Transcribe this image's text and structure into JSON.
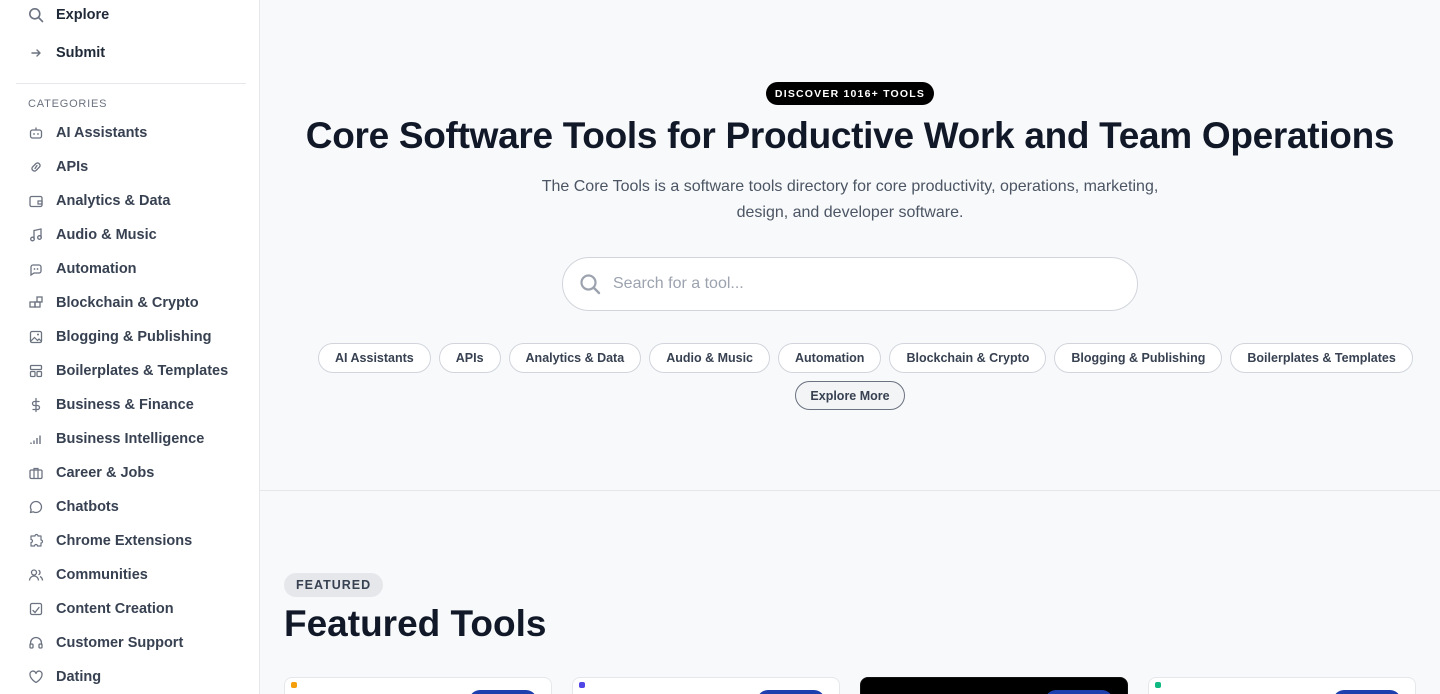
{
  "sidebar": {
    "top_items": [
      {
        "label": "Explore",
        "icon": "search-icon"
      },
      {
        "label": "Submit",
        "icon": "arrow-right-icon"
      }
    ],
    "categories_heading": "CATEGORIES",
    "categories": [
      {
        "label": "AI Assistants",
        "icon": "bot-icon"
      },
      {
        "label": "APIs",
        "icon": "link-icon"
      },
      {
        "label": "Analytics & Data",
        "icon": "wallet-icon"
      },
      {
        "label": "Audio & Music",
        "icon": "music-icon"
      },
      {
        "label": "Automation",
        "icon": "robot-icon"
      },
      {
        "label": "Blockchain & Crypto",
        "icon": "blocks-icon"
      },
      {
        "label": "Blogging & Publishing",
        "icon": "image-icon"
      },
      {
        "label": "Boilerplates & Templates",
        "icon": "template-icon"
      },
      {
        "label": "Business & Finance",
        "icon": "dollar-icon"
      },
      {
        "label": "Business Intelligence",
        "icon": "signal-icon"
      },
      {
        "label": "Career & Jobs",
        "icon": "briefcase-icon"
      },
      {
        "label": "Chatbots",
        "icon": "chat-bubble-icon"
      },
      {
        "label": "Chrome Extensions",
        "icon": "puzzle-icon"
      },
      {
        "label": "Communities",
        "icon": "users-icon"
      },
      {
        "label": "Content Creation",
        "icon": "edit-image-icon"
      },
      {
        "label": "Customer Support",
        "icon": "headset-icon"
      },
      {
        "label": "Dating",
        "icon": "heart-icon"
      }
    ]
  },
  "hero": {
    "badge": "DISCOVER 1016+ TOOLS",
    "title": "Core Software Tools for Productive Work and Team Operations",
    "subtitle_line1": "The Core Tools is a software tools directory for core productivity, operations, marketing,",
    "subtitle_line2": "design, and developer software.",
    "search_placeholder": "Search for a tool...",
    "search_value": "",
    "chips": [
      "AI Assistants",
      "APIs",
      "Analytics & Data",
      "Audio & Music",
      "Automation",
      "Blockchain & Crypto",
      "Blogging & Publishing",
      "Boilerplates & Templates"
    ],
    "explore_more": "Explore More"
  },
  "featured": {
    "tag": "FEATURED",
    "title": "Featured Tools"
  },
  "colors": {
    "accent": "#1e40af",
    "badge_bg": "#000000",
    "page_bg": "#f8f9fb"
  }
}
